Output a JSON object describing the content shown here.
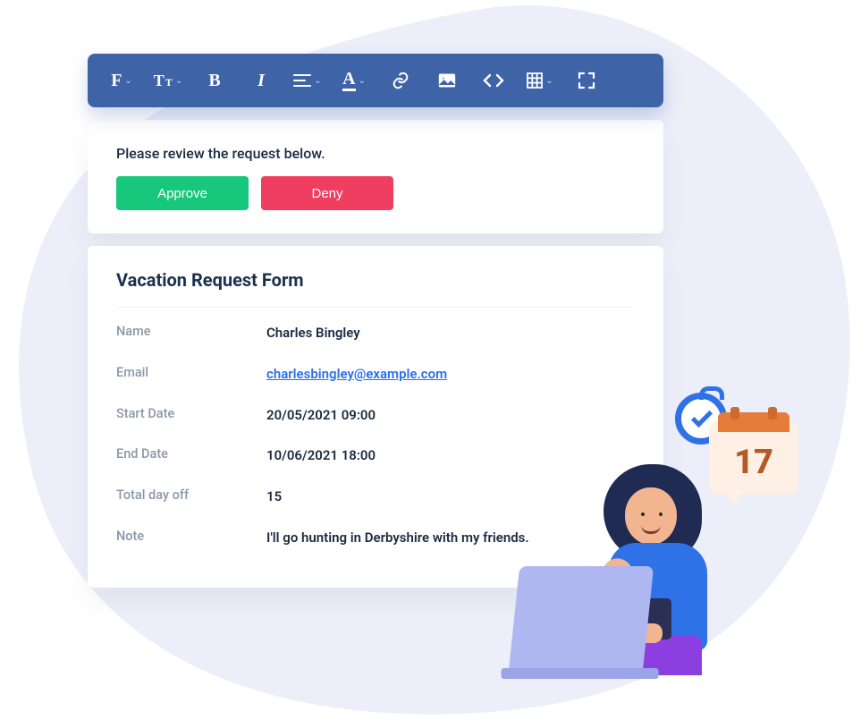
{
  "toolbar": {
    "items": [
      {
        "name": "font-family-menu",
        "icon": "font",
        "caret": true
      },
      {
        "name": "font-size-menu",
        "icon": "text-size",
        "caret": true
      },
      {
        "name": "bold-button",
        "icon": "bold",
        "caret": false
      },
      {
        "name": "italic-button",
        "icon": "italic",
        "caret": false
      },
      {
        "name": "align-menu",
        "icon": "align",
        "caret": true
      },
      {
        "name": "text-color-menu",
        "icon": "text-color",
        "caret": true
      },
      {
        "name": "insert-link-button",
        "icon": "link",
        "caret": false
      },
      {
        "name": "insert-image-button",
        "icon": "image",
        "caret": false
      },
      {
        "name": "code-view-button",
        "icon": "code",
        "caret": false
      },
      {
        "name": "insert-table-menu",
        "icon": "table",
        "caret": true
      },
      {
        "name": "fullscreen-button",
        "icon": "expand",
        "caret": false
      }
    ]
  },
  "review": {
    "prompt": "Please review the request below.",
    "approve_label": "Approve",
    "deny_label": "Deny"
  },
  "form": {
    "title": "Vacation Request Form",
    "fields": [
      {
        "label": "Name",
        "value": "Charles Bingley",
        "type": "text"
      },
      {
        "label": "Email",
        "value": "charlesbingley@example.com",
        "type": "email"
      },
      {
        "label": "Start Date",
        "value": "20/05/2021 09:00",
        "type": "text"
      },
      {
        "label": "End Date",
        "value": "10/06/2021 18:00",
        "type": "text"
      },
      {
        "label": "Total day off",
        "value": "15",
        "type": "text"
      },
      {
        "label": "Note",
        "value": "I'll go hunting in Derbyshire with my friends.",
        "type": "text"
      }
    ]
  },
  "decor": {
    "calendar_day": "17"
  },
  "colors": {
    "toolbar_bg": "#3f63a7",
    "approve": "#17c77b",
    "deny": "#ef3e60",
    "link": "#2a6fe8",
    "blob": "#eceef9"
  }
}
